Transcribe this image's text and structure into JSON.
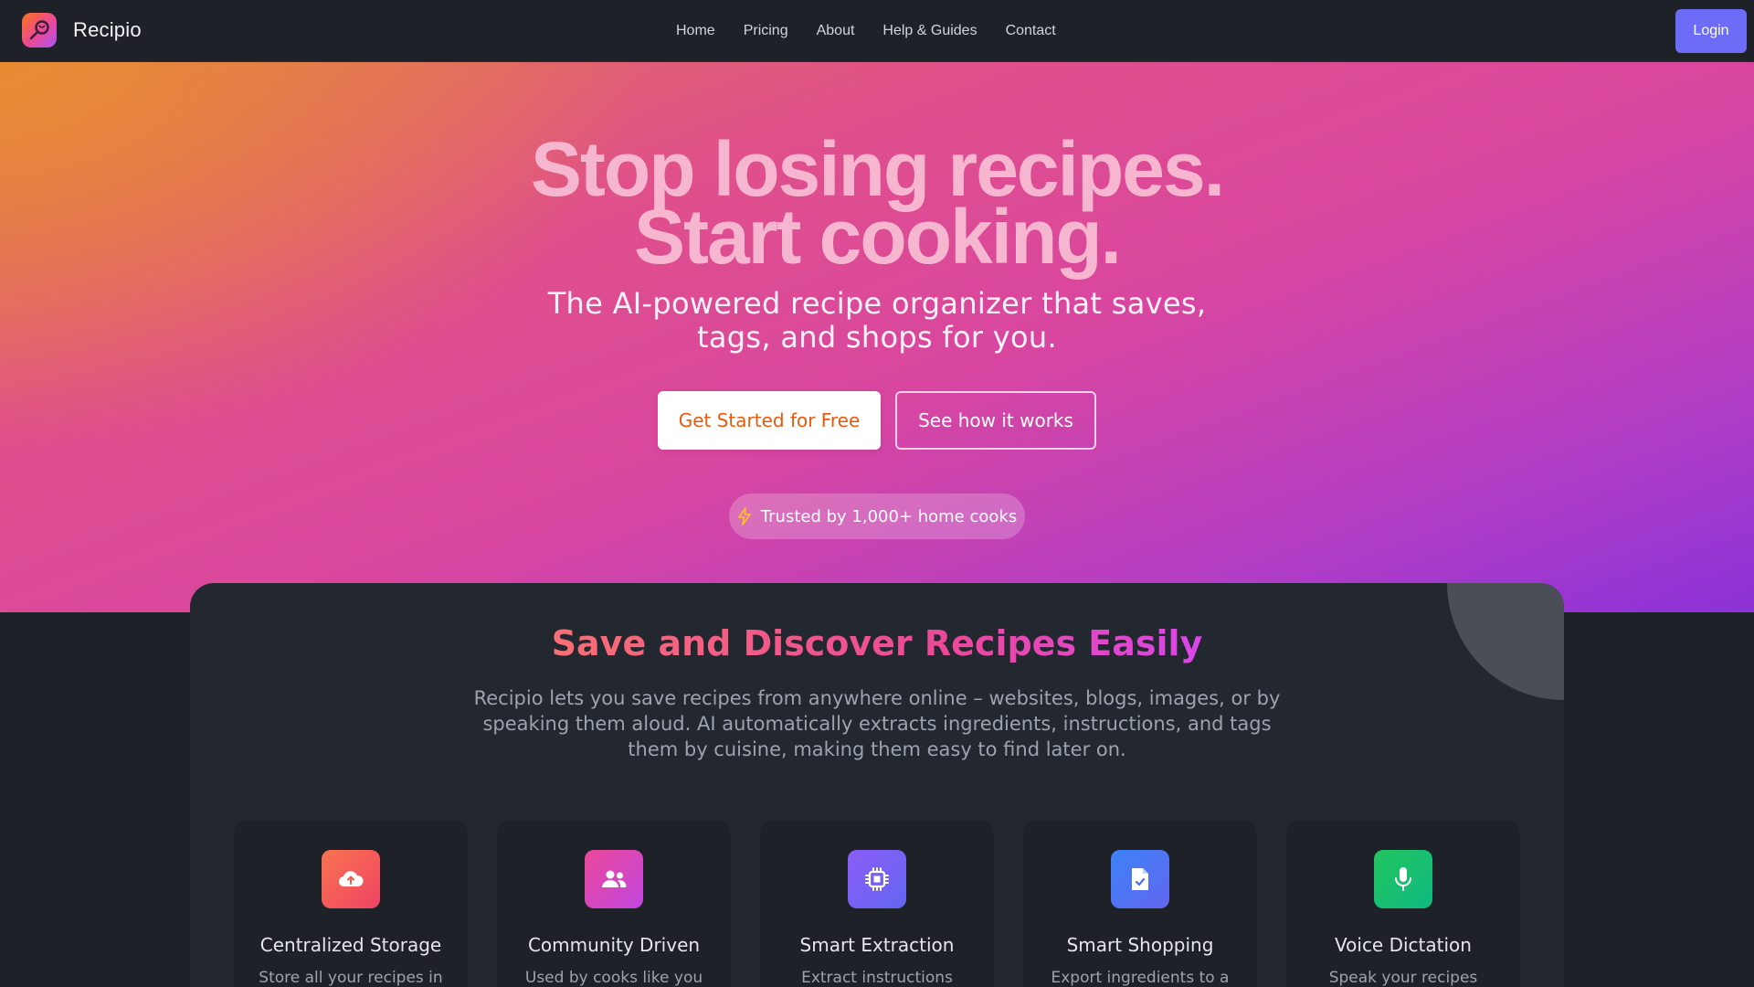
{
  "brand": {
    "name": "Recipio"
  },
  "nav": {
    "items": [
      {
        "label": "Home"
      },
      {
        "label": "Pricing"
      },
      {
        "label": "About"
      },
      {
        "label": "Help & Guides"
      },
      {
        "label": "Contact"
      }
    ],
    "login_label": "Login"
  },
  "hero": {
    "title_line1": "Stop losing recipes.",
    "title_line2": "Start cooking.",
    "subtitle": "The AI-powered recipe organizer that saves, tags, and shops for you.",
    "primary_cta": "Get Started for Free",
    "secondary_cta": "See how it works",
    "trust_text": "Trusted by 1,000+ home cooks"
  },
  "features_section": {
    "title": "Save and Discover Recipes Easily",
    "description": "Recipio lets you save recipes from anywhere online – websites, blogs, images, or by speaking them aloud. AI automatically extracts ingredients, instructions, and tags them by cuisine, making them easy to find later on.",
    "items": [
      {
        "title": "Centralized Storage",
        "desc": "Store all your recipes in",
        "icon": "cloud-upload-icon",
        "color": "#f25c4c"
      },
      {
        "title": "Community Driven",
        "desc": "Used by cooks like you",
        "icon": "users-icon",
        "color": "#d946c8"
      },
      {
        "title": "Smart Extraction",
        "desc": "Extract instructions",
        "icon": "chip-icon",
        "color": "#7b5cf0"
      },
      {
        "title": "Smart Shopping",
        "desc": "Export ingredients to a",
        "icon": "document-check-icon",
        "color": "#4f6ef0"
      },
      {
        "title": "Voice Dictation",
        "desc": "Speak your recipes",
        "icon": "microphone-icon",
        "color": "#22b573"
      }
    ]
  },
  "colors": {
    "nav_bg": "#1e2128",
    "login_bg": "#6d6cf6",
    "cta_text": "#ea580c"
  }
}
